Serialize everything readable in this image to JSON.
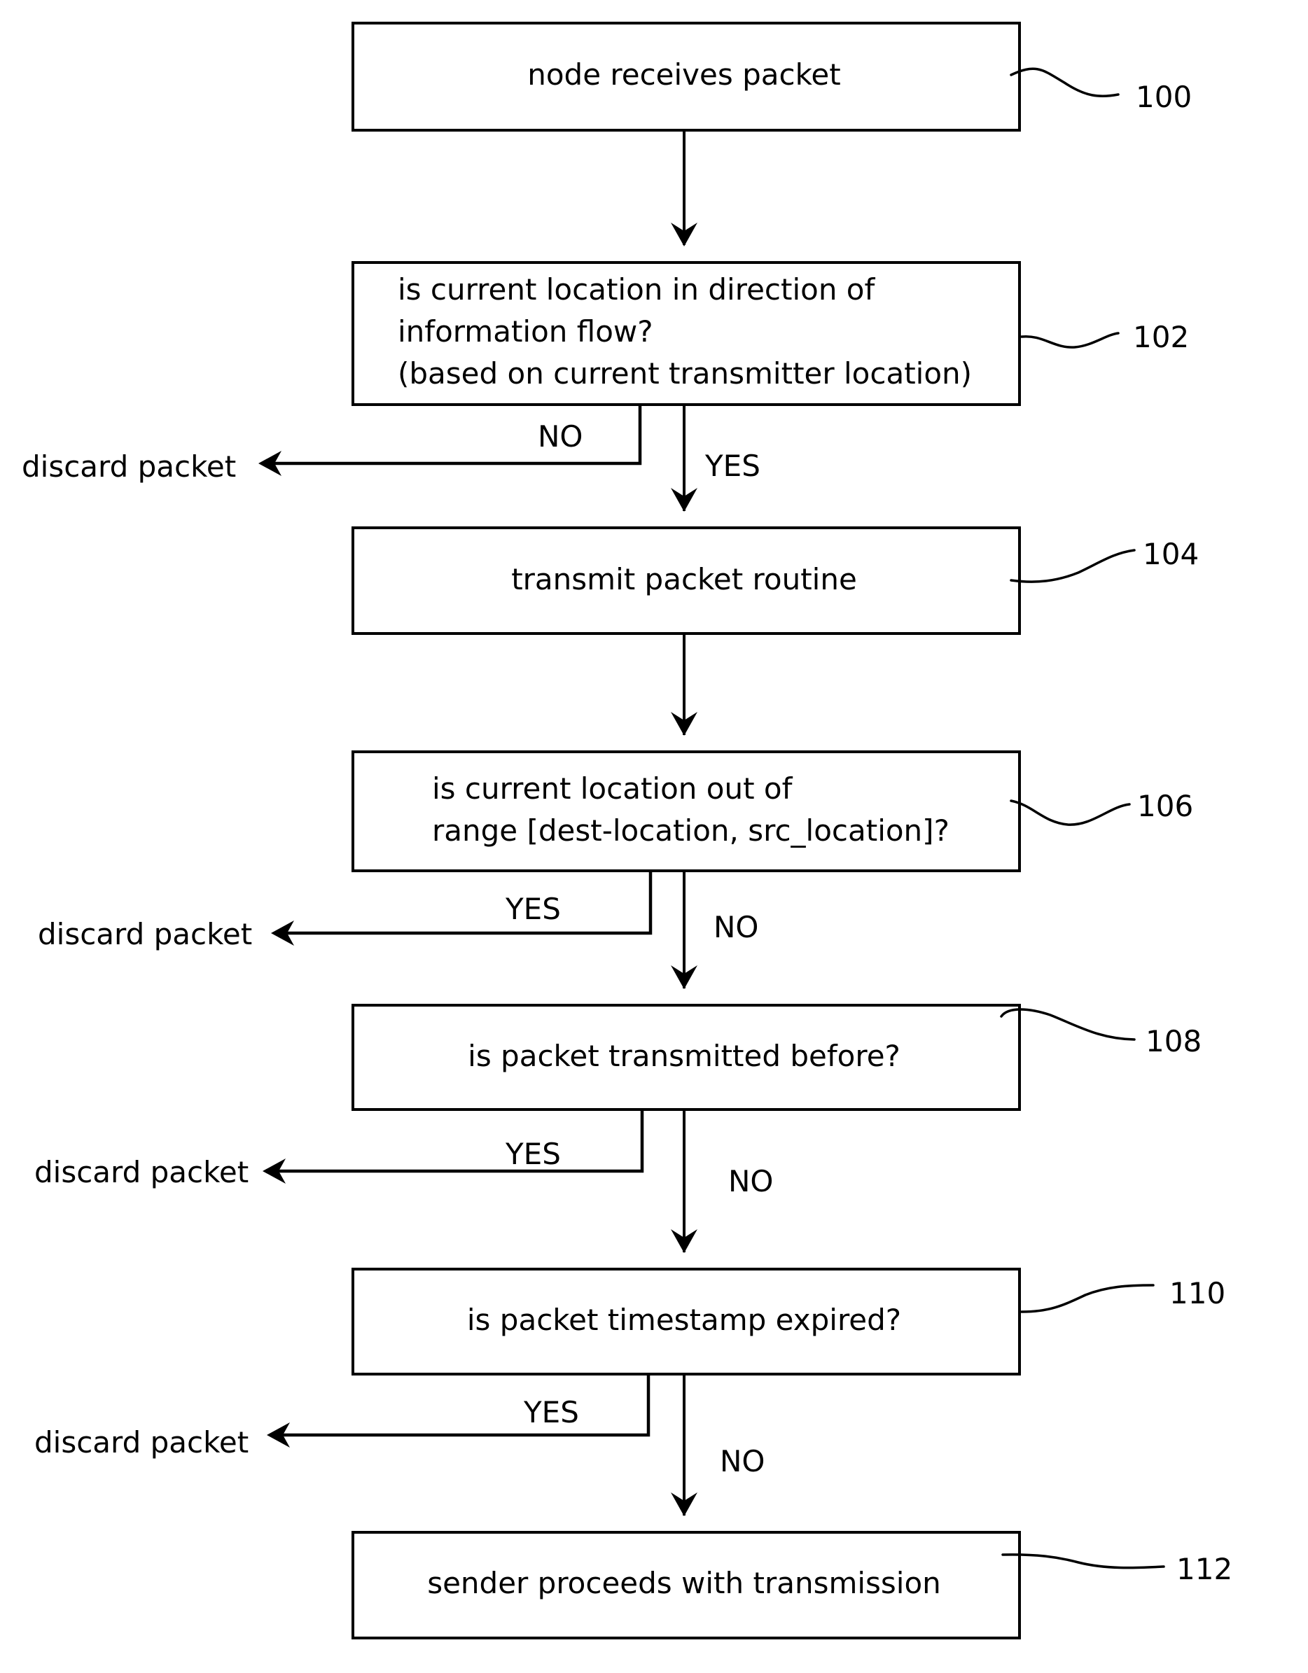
{
  "diagram": {
    "type": "flowchart",
    "steps": [
      {
        "ref": "100",
        "lines": [
          "node receives packet"
        ]
      },
      {
        "ref": "102",
        "lines": [
          "is current location in direction of",
          "information flow?",
          "(based on current transmitter location)"
        ]
      },
      {
        "ref": "104",
        "lines": [
          "transmit packet routine"
        ]
      },
      {
        "ref": "106",
        "lines": [
          "is current location out of",
          "range [dest-location, src_location]?"
        ]
      },
      {
        "ref": "108",
        "lines": [
          "is packet transmitted before?"
        ]
      },
      {
        "ref": "110",
        "lines": [
          "is packet timestamp expired?"
        ]
      },
      {
        "ref": "112",
        "lines": [
          "sender proceeds with transmission"
        ]
      }
    ],
    "branches": [
      {
        "from": "102",
        "discard_condition": "NO",
        "continue_condition": "YES",
        "discard_label": "discard packet"
      },
      {
        "from": "106",
        "discard_condition": "YES",
        "continue_condition": "NO",
        "discard_label": "discard packet"
      },
      {
        "from": "108",
        "discard_condition": "YES",
        "continue_condition": "NO",
        "discard_label": "discard packet"
      },
      {
        "from": "110",
        "discard_condition": "YES",
        "continue_condition": "NO",
        "discard_label": "discard packet"
      }
    ]
  }
}
